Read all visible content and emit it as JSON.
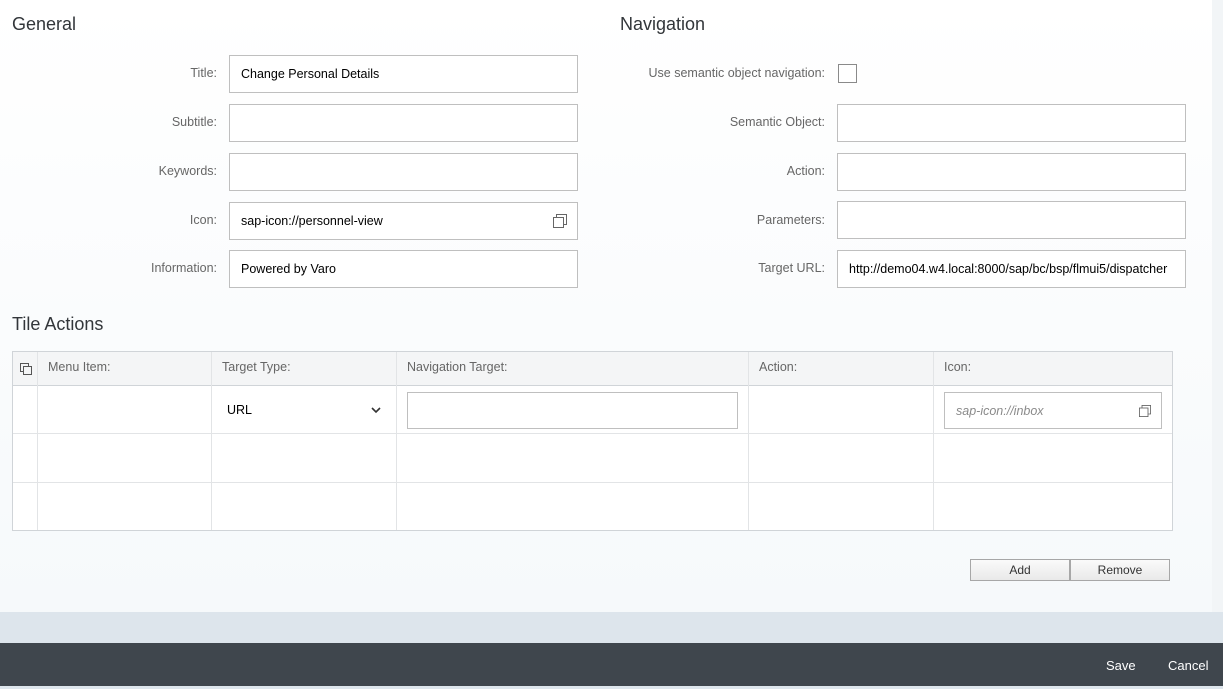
{
  "general": {
    "title": "General",
    "fields": {
      "title_label": "Title:",
      "title_value": "Change Personal Details",
      "subtitle_label": "Subtitle:",
      "subtitle_value": "",
      "keywords_label": "Keywords:",
      "keywords_value": "",
      "icon_label": "Icon:",
      "icon_value": "sap-icon://personnel-view",
      "information_label": "Information:",
      "information_value": "Powered by Varo"
    }
  },
  "navigation": {
    "title": "Navigation",
    "semantic_nav_label": "Use semantic object navigation:",
    "semantic_nav_checked": false,
    "semantic_object_label": "Semantic Object:",
    "semantic_object_value": "",
    "action_label": "Action:",
    "action_value": "",
    "parameters_label": "Parameters:",
    "parameters_value": "",
    "target_url_label": "Target URL:",
    "target_url_value": "http://demo04.w4.local:8000/sap/bc/bsp/flmui5/dispatcher"
  },
  "tile_actions": {
    "title": "Tile Actions",
    "columns": [
      "Menu Item:",
      "Target Type:",
      "Navigation Target:",
      "Action:",
      "Icon:"
    ],
    "rows": [
      {
        "menu_item": "",
        "target_type": "URL",
        "navigation_target": "",
        "action": "",
        "icon_placeholder": "sap-icon://inbox"
      }
    ],
    "add_label": "Add",
    "remove_label": "Remove"
  },
  "footer": {
    "save_label": "Save",
    "cancel_label": "Cancel"
  },
  "colors": {
    "footer_bg": "#3f464d",
    "page_bg": "#dde5ec",
    "field_border": "#bfbfbf"
  }
}
